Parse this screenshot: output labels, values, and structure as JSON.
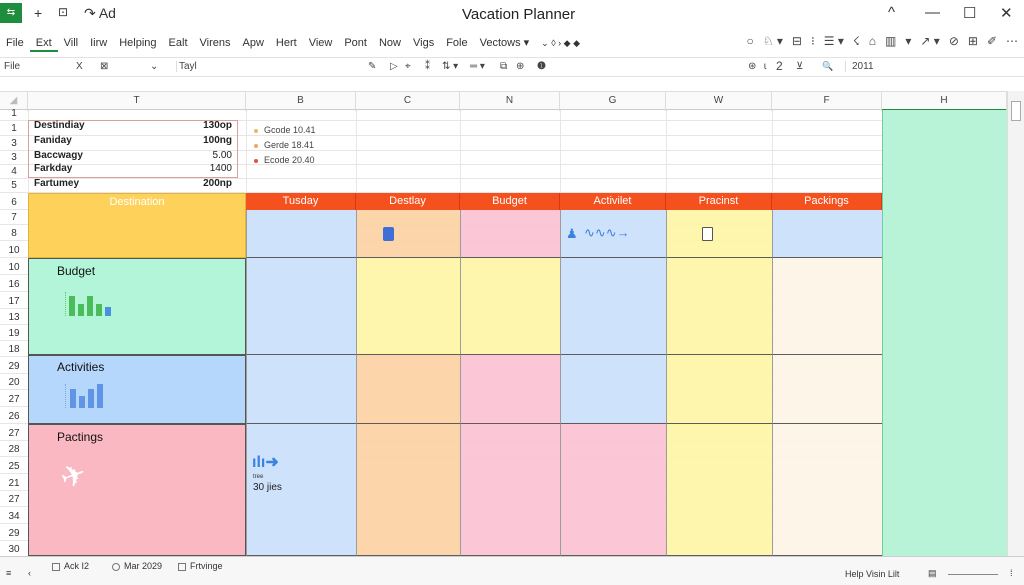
{
  "title_bar": {
    "app_icon": "sheets-logo-icon",
    "quick_access": [
      "+",
      "⊡",
      "↷ Ad"
    ],
    "title": "Vacation Planner",
    "controls": [
      "^",
      "—",
      "☐",
      "✕"
    ]
  },
  "menu": {
    "items": [
      "File",
      "Ext",
      "Vill",
      "Iirw",
      "Helping",
      "Ealt",
      "Virens",
      "Apw",
      "Hert",
      "View",
      "Pont",
      "Now",
      "Vigs",
      "Fole",
      "Vectows ▾",
      "⌄ ◊ › ◆ ◆"
    ],
    "active": 1
  },
  "toolbar_right": [
    "○",
    "♘ ▾",
    "⊟",
    "⁝",
    "☰ ▾",
    "☇",
    "⌂",
    "▥",
    "▾",
    "↗ ▾",
    "⊘",
    "⊞",
    "✐",
    "⋯"
  ],
  "formula_bar": {
    "name_box": "File",
    "close": "X",
    "fx": "⊠",
    "dropdown": "⌄",
    "input": "Tayl",
    "tools": [
      "✎",
      "▷",
      "⌖",
      "⁑",
      "⇅ ▾",
      "═ ▾",
      "⧉",
      "⊕",
      "❶"
    ],
    "right_tools": [
      "⊛",
      "ɩ",
      "2",
      "⊻"
    ],
    "search_icon": "🔍",
    "search_value": "2011"
  },
  "columns": [
    "T",
    "B",
    "C",
    "N",
    "G",
    "W",
    "F",
    "H"
  ],
  "rows": [
    "1",
    "1",
    "3",
    "3",
    "4",
    "5",
    "6",
    "7",
    "8",
    "10",
    "10",
    "16",
    "17",
    "13",
    "19",
    "18",
    "29",
    "20",
    "27",
    "26",
    "27",
    "28",
    "25",
    "21",
    "27",
    "34",
    "29",
    "30"
  ],
  "summary": [
    {
      "label": "Destindiay",
      "value": "130op"
    },
    {
      "label": "Faniday",
      "value": "100ng"
    },
    {
      "label": "Baccwagy",
      "value": "5.00"
    },
    {
      "label": "Farkday",
      "value": "1400"
    },
    {
      "label": "Fartumey",
      "value": "200np"
    }
  ],
  "legend": [
    {
      "label": "Gcode 10.41",
      "color": "#e8b860"
    },
    {
      "label": "Gerde 18.41",
      "color": "#e8a860"
    },
    {
      "label": "Ecode 20.40",
      "color": "#e05050"
    }
  ],
  "header_band": {
    "first": "Destination",
    "items": [
      "Tusday",
      "Destlay",
      "Budget",
      "Activilet",
      "Pracinst",
      "Packings"
    ],
    "color": "#f4511e"
  },
  "sections": [
    "Budget",
    "Activities",
    "Pactings"
  ],
  "charts": {
    "budget": [
      0.9,
      0.55,
      0.9,
      0.55,
      0.4
    ],
    "activities": [
      0.8,
      0.5,
      0.8,
      1.0
    ]
  },
  "flight_note": {
    "small": "tree",
    "label": "30 jies"
  },
  "bottom": {
    "tabs": [
      "Ack I2",
      "Mar 2029",
      "Frtvinge"
    ],
    "status": "Help Visin Lilt"
  }
}
